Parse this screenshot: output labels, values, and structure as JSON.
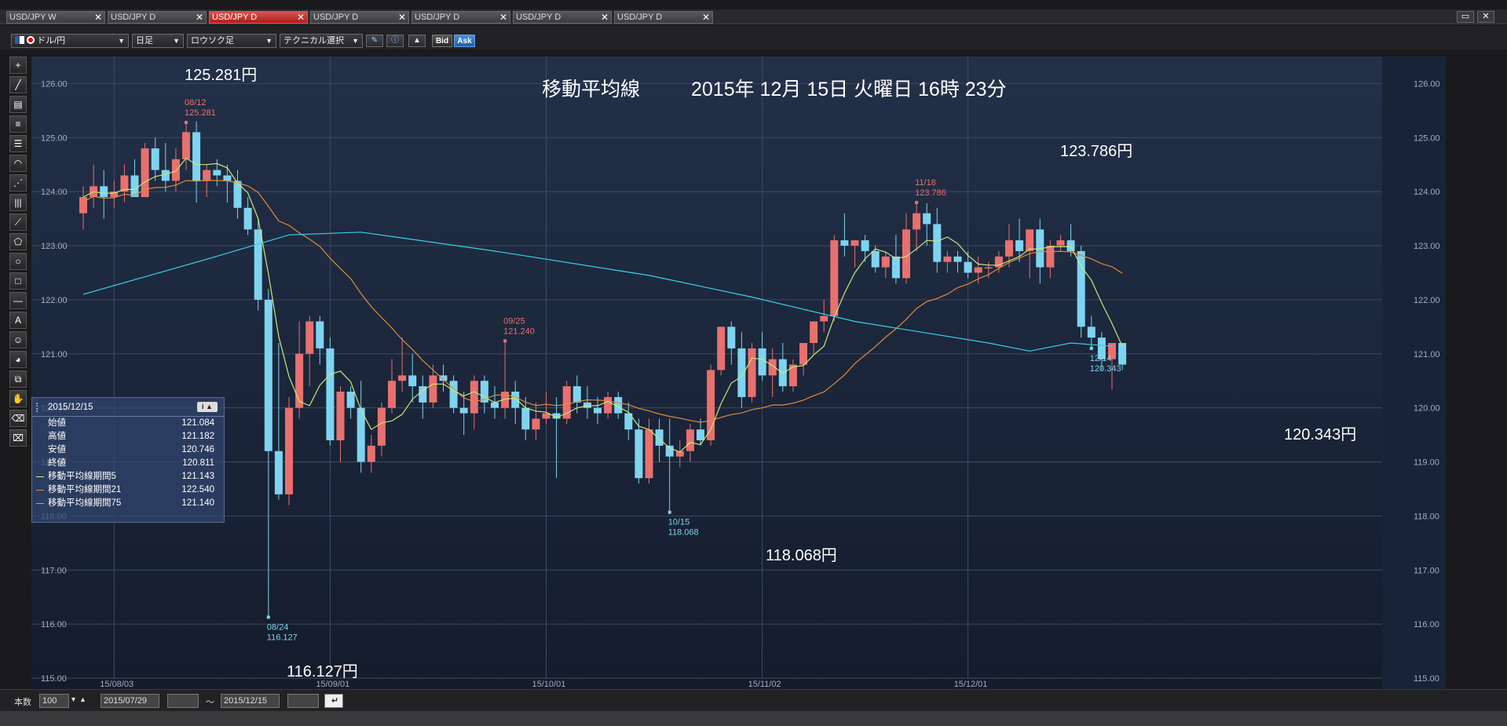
{
  "tabs": [
    {
      "label": "USD/JPY W",
      "active": false
    },
    {
      "label": "USD/JPY D",
      "active": false
    },
    {
      "label": "USD/JPY D",
      "active": true
    },
    {
      "label": "USD/JPY D",
      "active": false
    },
    {
      "label": "USD/JPY D",
      "active": false
    },
    {
      "label": "USD/JPY D",
      "active": false
    },
    {
      "label": "USD/JPY D",
      "active": false
    }
  ],
  "tab_close_glyph": "✕",
  "window_buttons": [
    "restore-icon",
    "close-icon"
  ],
  "toolbar": {
    "currency_pair": "ドル/円",
    "period": "日足",
    "chart_style": "ロウソク足",
    "technical_select": "テクニカル選択",
    "bid_label": "Bid",
    "ask_label": "Ask"
  },
  "tools": [
    "crosshair-icon",
    "line-icon",
    "ruler-icon",
    "hlines-icon",
    "multi-hlines-icon",
    "arc-icon",
    "fan-icon",
    "vlines-icon",
    "channel-icon",
    "pentagon-icon",
    "circle-icon",
    "rectangle-icon",
    "horizontal-line-icon",
    "text-icon",
    "emoji-icon",
    "paint-icon",
    "copy-icon",
    "hand-icon",
    "eraser-icon",
    "eraser-all-icon"
  ],
  "annotation": {
    "heading": "移動平均線",
    "datetime": "2015年 12月 15日 火曜日 16時 23分",
    "high_big": "125.281円",
    "low_big": "116.127円",
    "mid_low_big": "118.068円",
    "mid_high_big": "123.786円",
    "last_low_big": "120.343円"
  },
  "info_panel": {
    "date": "2015/12/15",
    "rows": [
      {
        "label": "始値",
        "value": "121.084"
      },
      {
        "label": "高値",
        "value": "121.182"
      },
      {
        "label": "安値",
        "value": "120.746"
      },
      {
        "label": "終値",
        "value": "120.811"
      },
      {
        "label": "移動平均線期間5",
        "value": "121.143",
        "color": "#c8e878"
      },
      {
        "label": "移動平均線期間21",
        "value": "122.540",
        "color": "#e08a3a"
      },
      {
        "label": "移動平均線期間75",
        "value": "121.140",
        "color": "#3ad0e0"
      }
    ]
  },
  "bottom": {
    "count_label": "本数",
    "count_value": "100",
    "from_date": "2015/07/29",
    "tilde": "～",
    "to_date": "2015/12/15"
  },
  "chart_data": {
    "type": "candlestick",
    "ylim": [
      115,
      126.5
    ],
    "yticks": [
      "126.00",
      "125.00",
      "124.00",
      "123.00",
      "122.00",
      "121.00",
      "120.00",
      "119.00",
      "118.00",
      "117.00",
      "116.00",
      "115.00"
    ],
    "xticks": [
      "15/08/03",
      "15/09/01",
      "15/10/01",
      "15/11/02",
      "15/12/01"
    ],
    "xtick_index": [
      3,
      24,
      45,
      66,
      86
    ],
    "up_color": "#e8706e",
    "down_color": "#7ed4f0",
    "point_labels": [
      {
        "date": "08/12",
        "value": "125.281",
        "index": 10,
        "kind": "high"
      },
      {
        "date": "08/24",
        "value": "116.127",
        "index": 18,
        "kind": "low"
      },
      {
        "date": "09/25",
        "value": "121.240",
        "index": 41,
        "kind": "high"
      },
      {
        "date": "10/15",
        "value": "118.068",
        "index": 57,
        "kind": "low"
      },
      {
        "date": "11/18",
        "value": "123.786",
        "index": 81,
        "kind": "high"
      },
      {
        "date": "12/14",
        "value": "120.343",
        "index": 98,
        "kind": "low"
      }
    ],
    "ohlc": [
      [
        123.6,
        124.1,
        123.3,
        123.9
      ],
      [
        123.9,
        124.5,
        123.7,
        124.1
      ],
      [
        124.1,
        124.4,
        123.5,
        123.9
      ],
      [
        123.9,
        124.2,
        123.7,
        124.0
      ],
      [
        124.0,
        124.5,
        123.8,
        124.3
      ],
      [
        124.3,
        124.6,
        123.9,
        123.9
      ],
      [
        123.9,
        124.9,
        123.9,
        124.8
      ],
      [
        124.8,
        125.0,
        124.2,
        124.4
      ],
      [
        124.4,
        124.9,
        124.0,
        124.2
      ],
      [
        124.2,
        124.8,
        124.0,
        124.6
      ],
      [
        124.6,
        125.281,
        124.4,
        125.1
      ],
      [
        125.1,
        125.3,
        123.8,
        124.2
      ],
      [
        124.2,
        124.5,
        123.9,
        124.4
      ],
      [
        124.4,
        124.6,
        124.1,
        124.3
      ],
      [
        124.3,
        124.5,
        123.8,
        124.2
      ],
      [
        124.2,
        124.4,
        123.5,
        123.7
      ],
      [
        123.7,
        123.9,
        123.2,
        123.3
      ],
      [
        123.3,
        123.5,
        121.8,
        122.0
      ],
      [
        122.0,
        122.2,
        116.127,
        119.2
      ],
      [
        119.2,
        121.2,
        118.3,
        118.4
      ],
      [
        118.4,
        120.2,
        118.2,
        120.0
      ],
      [
        120.0,
        121.6,
        119.8,
        121.0
      ],
      [
        121.0,
        121.7,
        120.4,
        121.6
      ],
      [
        121.6,
        121.7,
        120.8,
        121.1
      ],
      [
        121.1,
        121.3,
        119.3,
        119.4
      ],
      [
        119.4,
        120.4,
        119.0,
        120.3
      ],
      [
        120.3,
        120.4,
        119.8,
        120.0
      ],
      [
        120.0,
        120.5,
        118.8,
        119.0
      ],
      [
        119.0,
        119.5,
        118.8,
        119.3
      ],
      [
        119.3,
        120.1,
        119.1,
        120.0
      ],
      [
        120.0,
        120.9,
        119.9,
        120.5
      ],
      [
        120.5,
        121.3,
        120.3,
        120.6
      ],
      [
        120.6,
        121.0,
        120.1,
        120.4
      ],
      [
        120.4,
        120.6,
        119.8,
        120.1
      ],
      [
        120.1,
        120.8,
        120.0,
        120.6
      ],
      [
        120.6,
        120.8,
        120.3,
        120.5
      ],
      [
        120.5,
        120.6,
        119.9,
        120.0
      ],
      [
        120.0,
        120.3,
        119.5,
        119.9
      ],
      [
        119.9,
        120.6,
        119.6,
        120.5
      ],
      [
        120.5,
        120.6,
        119.9,
        120.1
      ],
      [
        120.1,
        120.4,
        119.8,
        120.0
      ],
      [
        120.0,
        121.24,
        119.8,
        120.3
      ],
      [
        120.3,
        120.5,
        119.7,
        120.0
      ],
      [
        120.0,
        120.2,
        119.4,
        119.6
      ],
      [
        119.6,
        120.1,
        119.4,
        119.8
      ],
      [
        119.8,
        120.3,
        119.7,
        119.9
      ],
      [
        119.9,
        120.2,
        118.7,
        119.8
      ],
      [
        119.8,
        120.5,
        119.7,
        120.4
      ],
      [
        120.4,
        120.6,
        119.9,
        120.1
      ],
      [
        120.1,
        120.4,
        119.8,
        120.0
      ],
      [
        120.0,
        120.2,
        119.7,
        119.9
      ],
      [
        119.9,
        120.3,
        119.8,
        120.2
      ],
      [
        120.2,
        120.3,
        119.8,
        119.9
      ],
      [
        119.9,
        120.1,
        119.4,
        119.6
      ],
      [
        119.6,
        119.8,
        118.6,
        118.7
      ],
      [
        118.7,
        119.8,
        118.6,
        119.6
      ],
      [
        119.6,
        119.8,
        119.0,
        119.3
      ],
      [
        119.3,
        119.8,
        118.068,
        119.1
      ],
      [
        119.1,
        119.4,
        118.9,
        119.2
      ],
      [
        119.2,
        119.7,
        119.0,
        119.6
      ],
      [
        119.6,
        119.8,
        119.3,
        119.4
      ],
      [
        119.4,
        120.8,
        119.3,
        120.7
      ],
      [
        120.7,
        121.5,
        120.6,
        121.5
      ],
      [
        121.5,
        121.6,
        120.8,
        121.1
      ],
      [
        121.1,
        121.4,
        120.0,
        120.2
      ],
      [
        120.2,
        121.2,
        120.1,
        121.1
      ],
      [
        121.1,
        121.4,
        120.5,
        120.6
      ],
      [
        120.6,
        121.1,
        120.2,
        120.9
      ],
      [
        120.9,
        121.2,
        120.3,
        120.4
      ],
      [
        120.4,
        120.9,
        120.3,
        120.8
      ],
      [
        120.8,
        121.2,
        120.6,
        121.2
      ],
      [
        121.2,
        121.6,
        121.0,
        121.6
      ],
      [
        121.6,
        122.0,
        121.4,
        121.7
      ],
      [
        121.7,
        123.2,
        121.6,
        123.1
      ],
      [
        123.1,
        123.6,
        122.8,
        123.0
      ],
      [
        123.0,
        123.1,
        122.6,
        123.1
      ],
      [
        123.1,
        123.2,
        122.7,
        122.9
      ],
      [
        122.9,
        123.0,
        122.5,
        122.6
      ],
      [
        122.6,
        122.9,
        122.4,
        122.8
      ],
      [
        122.8,
        123.2,
        122.3,
        122.4
      ],
      [
        122.4,
        123.6,
        122.3,
        123.3
      ],
      [
        123.3,
        123.8,
        122.9,
        123.6
      ],
      [
        123.6,
        123.786,
        123.0,
        123.4
      ],
      [
        123.4,
        123.7,
        122.5,
        122.7
      ],
      [
        122.7,
        122.9,
        122.5,
        122.8
      ],
      [
        122.8,
        122.9,
        122.5,
        122.7
      ],
      [
        122.7,
        122.9,
        122.4,
        122.5
      ],
      [
        122.5,
        122.8,
        122.3,
        122.6
      ],
      [
        122.6,
        122.7,
        122.4,
        122.6
      ],
      [
        122.6,
        122.9,
        122.5,
        122.8
      ],
      [
        122.8,
        123.4,
        122.6,
        123.1
      ],
      [
        123.1,
        123.5,
        122.7,
        122.9
      ],
      [
        122.9,
        123.3,
        122.4,
        123.3
      ],
      [
        123.3,
        123.5,
        122.3,
        122.6
      ],
      [
        122.6,
        123.1,
        122.4,
        123.0
      ],
      [
        123.0,
        123.2,
        122.9,
        123.1
      ],
      [
        123.1,
        123.4,
        122.8,
        122.9
      ],
      [
        122.9,
        123.0,
        121.3,
        121.5
      ],
      [
        121.5,
        121.7,
        121.1,
        121.3
      ],
      [
        121.3,
        121.4,
        120.7,
        120.9
      ],
      [
        120.9,
        121.2,
        120.343,
        121.2
      ],
      [
        121.2,
        121.2,
        120.7,
        120.8
      ]
    ],
    "ma75": [
      [
        0,
        122.1
      ],
      [
        12,
        122.75
      ],
      [
        20,
        123.2
      ],
      [
        27,
        123.25
      ],
      [
        40,
        122.9
      ],
      [
        55,
        122.45
      ],
      [
        65,
        122.05
      ],
      [
        75,
        121.6
      ],
      [
        88,
        121.2
      ],
      [
        92,
        121.05
      ],
      [
        96,
        121.2
      ],
      [
        100,
        121.14
      ]
    ]
  }
}
